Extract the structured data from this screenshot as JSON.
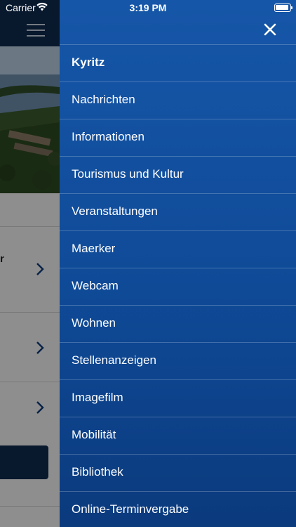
{
  "status_bar": {
    "carrier": "Carrier",
    "time": "3:19 PM"
  },
  "background": {
    "snippet_text": "r"
  },
  "drawer": {
    "close_icon": "close-icon",
    "items": [
      {
        "label": "Kyritz",
        "active": true
      },
      {
        "label": "Nachrichten"
      },
      {
        "label": "Informationen"
      },
      {
        "label": "Tourismus und Kultur"
      },
      {
        "label": "Veranstaltungen"
      },
      {
        "label": "Maerker"
      },
      {
        "label": "Webcam"
      },
      {
        "label": "Wohnen"
      },
      {
        "label": "Stellenanzeigen"
      },
      {
        "label": "Imagefilm"
      },
      {
        "label": "Mobilität"
      },
      {
        "label": "Bibliothek"
      },
      {
        "label": "Online-Terminvergabe"
      }
    ]
  },
  "colors": {
    "drawer_top": "#1656a8",
    "drawer_bottom": "#0b3a7d",
    "header_bg": "#0e2a4f",
    "text": "#ffffff"
  }
}
